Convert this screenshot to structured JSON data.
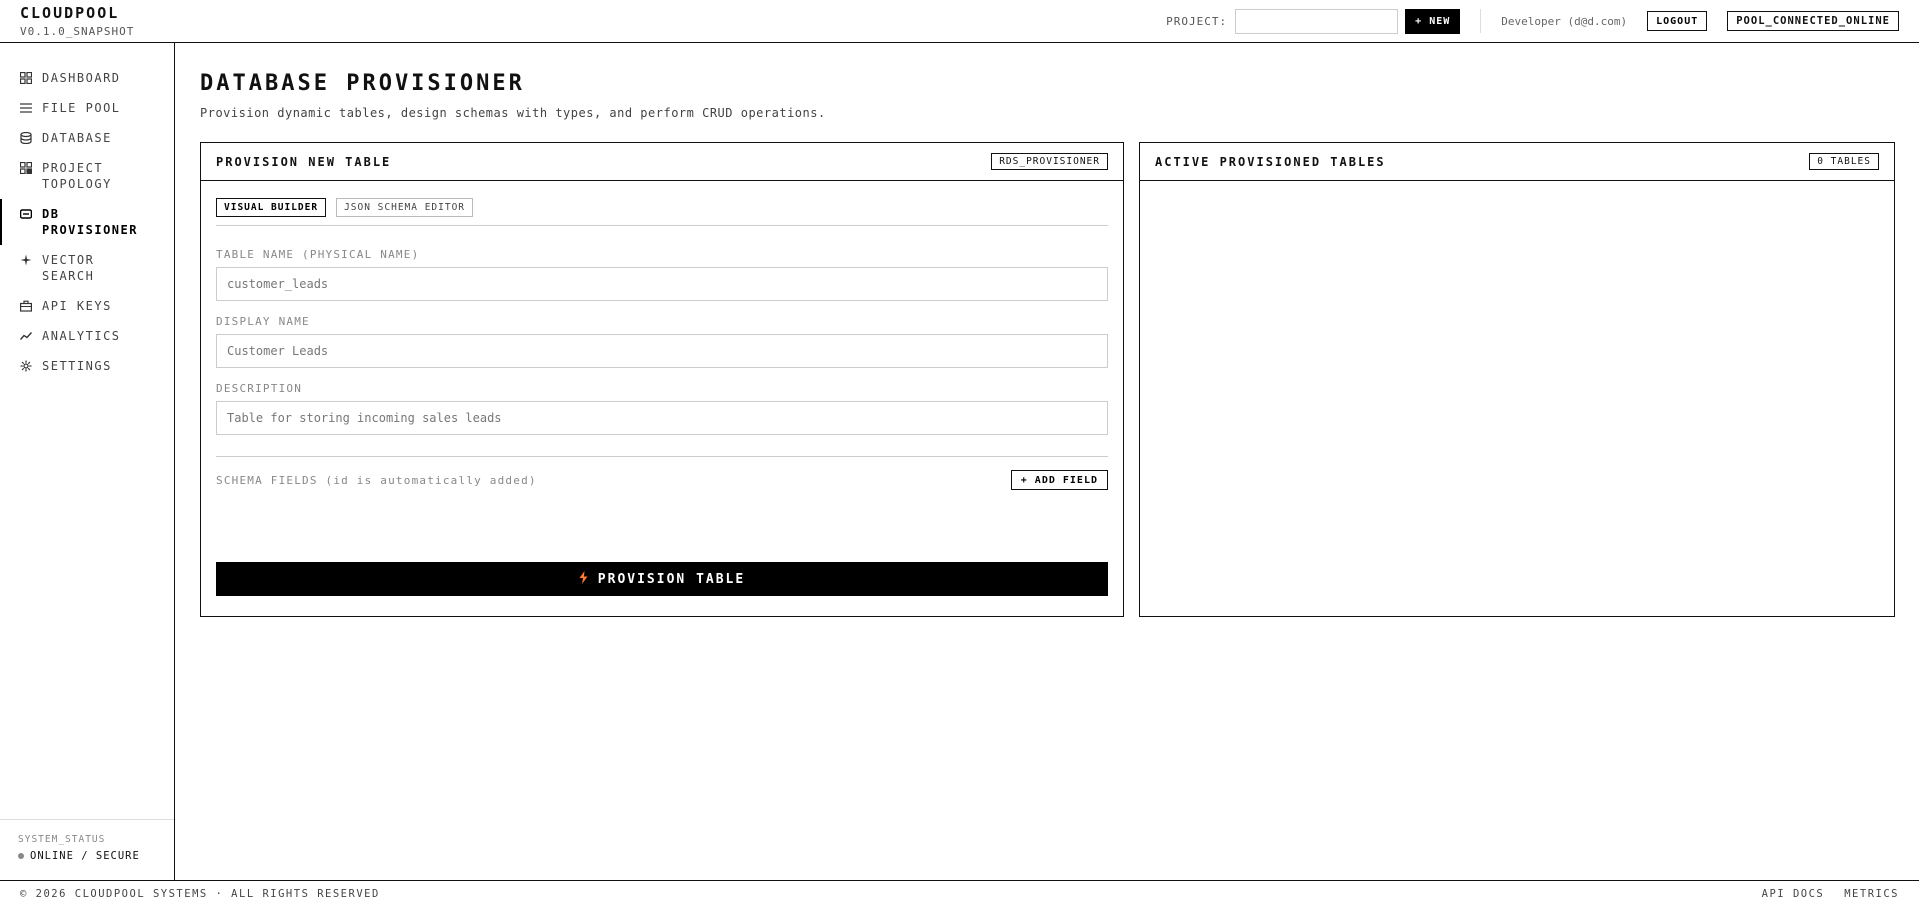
{
  "app": {
    "name": "CLOUDPOOL",
    "version": "V0.1.0_SNAPSHOT"
  },
  "header": {
    "project_label": "PROJECT:",
    "project_value": "",
    "new_button": "+ NEW",
    "user": "Developer (d@d.com)",
    "logout": "LOGOUT",
    "connection_status": "POOL_CONNECTED_ONLINE"
  },
  "sidebar": {
    "items": [
      {
        "label": "DASHBOARD",
        "icon": "grid-icon",
        "active": false
      },
      {
        "label": "FILE POOL",
        "icon": "list-icon",
        "active": false
      },
      {
        "label": "DATABASE",
        "icon": "database-icon",
        "active": false
      },
      {
        "label": "PROJECT\nTOPOLOGY",
        "icon": "topology-icon",
        "active": false
      },
      {
        "label": "DB\nPROVISIONER",
        "icon": "provisioner-icon",
        "active": true
      },
      {
        "label": "VECTOR SEARCH",
        "icon": "sparkle-icon",
        "active": false
      },
      {
        "label": "API KEYS",
        "icon": "briefcase-icon",
        "active": false
      },
      {
        "label": "ANALYTICS",
        "icon": "chart-icon",
        "active": false
      },
      {
        "label": "SETTINGS",
        "icon": "gear-icon",
        "active": false
      }
    ],
    "system_status_label": "SYSTEM_STATUS",
    "system_status_value": "ONLINE / SECURE"
  },
  "main": {
    "title": "DATABASE PROVISIONER",
    "subtitle": "Provision dynamic tables, design schemas with types, and perform CRUD operations.",
    "left_panel": {
      "title": "PROVISION NEW TABLE",
      "tag": "RDS_PROVISIONER",
      "tabs": [
        {
          "label": "VISUAL BUILDER",
          "active": true
        },
        {
          "label": "JSON SCHEMA EDITOR",
          "active": false
        }
      ],
      "table_name_label": "TABLE NAME (PHYSICAL NAME)",
      "table_name_placeholder": "customer_leads",
      "display_name_label": "DISPLAY NAME",
      "display_name_placeholder": "Customer Leads",
      "description_label": "DESCRIPTION",
      "description_placeholder": "Table for storing incoming sales leads",
      "schema_label": "SCHEMA FIELDS (id is automatically added)",
      "add_field": "+ ADD FIELD",
      "provision_button": "PROVISION TABLE"
    },
    "right_panel": {
      "title": "ACTIVE PROVISIONED TABLES",
      "tag": "0 TABLES"
    }
  },
  "footer": {
    "copyright": "© 2026 CLOUDPOOL SYSTEMS · ALL RIGHTS RESERVED",
    "links": [
      "API DOCS",
      "METRICS"
    ]
  },
  "colors": {
    "accent": "#000000",
    "bolt": "#ff7a2f",
    "status_dot": "#888888"
  }
}
